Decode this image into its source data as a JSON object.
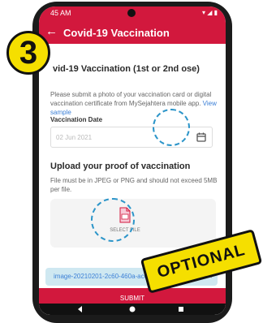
{
  "badge": {
    "step": "3"
  },
  "status_bar": {
    "time": "45 AM",
    "icons_label": "▾ ◢ ▮"
  },
  "app_bar": {
    "title": "Covid-19 Vaccination",
    "back_icon": "arrow-left-icon"
  },
  "form": {
    "section_title": "vid-19 Vaccination (1st or 2nd ose)",
    "description": "Please submit a photo of your vaccination card or digital vaccination certificate from MySejahtera mobile app.",
    "description_link": "View sample",
    "date_label": "Vaccination Date",
    "date_value": "02 Jun 2021",
    "upload_title": "Upload your proof of vaccination",
    "upload_description": "File must be in JPEG or PNG and should not exceed 5MB per file.",
    "select_file_label": "SELECT FILE",
    "uploaded_file_name": "image-20210201-2c60-460a-ac09-f700...",
    "submit_label": "SUBMIT"
  },
  "tag": {
    "optional": "OPTIONAL"
  },
  "colors": {
    "accent": "#d2183d",
    "highlight": "#2c95c9",
    "tag": "#f5df00",
    "file_chip": "#cfe8f1"
  }
}
